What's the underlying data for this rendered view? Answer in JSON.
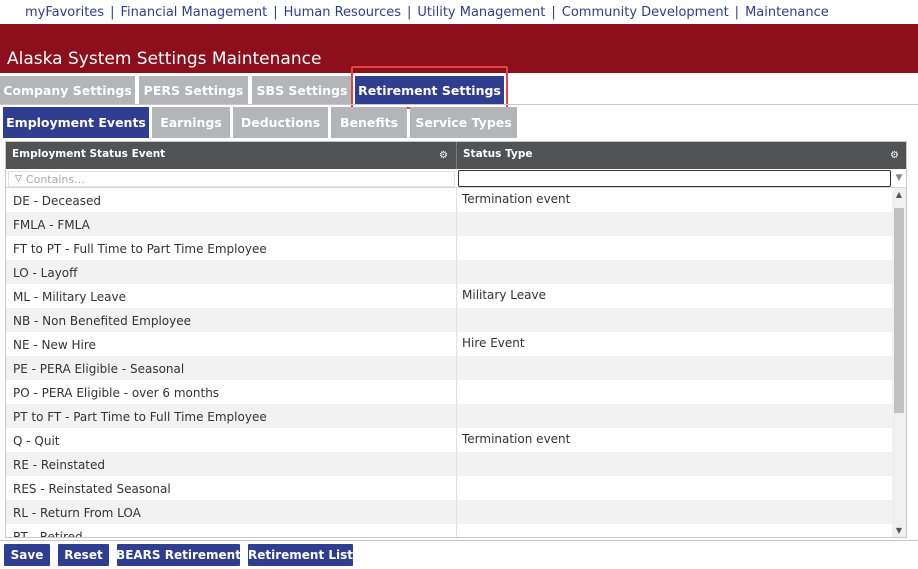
{
  "topnav": {
    "items": [
      "myFavorites",
      "Financial Management",
      "Human Resources",
      "Utility Management",
      "Community Development",
      "Maintenance"
    ],
    "separator": "|"
  },
  "header": {
    "title": "Alaska System Settings Maintenance"
  },
  "primary_tabs": [
    {
      "label": "Company Settings",
      "active": false
    },
    {
      "label": "PERS Settings",
      "active": false
    },
    {
      "label": "SBS Settings",
      "active": false
    },
    {
      "label": "Retirement Settings",
      "active": true
    }
  ],
  "secondary_tabs": [
    {
      "label": "Employment Events",
      "active": true
    },
    {
      "label": "Earnings",
      "active": false
    },
    {
      "label": "Deductions",
      "active": false
    },
    {
      "label": "Benefits",
      "active": false
    },
    {
      "label": "Service Types",
      "active": false
    }
  ],
  "grid": {
    "columns": [
      "Employment Status Event",
      "Status Type"
    ],
    "filter_placeholder": "Contains...",
    "status_type_filter_value": "",
    "rows": [
      [
        "DE - Deceased",
        "Termination event"
      ],
      [
        "FMLA - FMLA",
        ""
      ],
      [
        "FT to PT - Full Time to Part Time Employee",
        ""
      ],
      [
        "LO - Layoff",
        ""
      ],
      [
        "ML - Military Leave",
        "Military Leave"
      ],
      [
        "NB - Non Benefited Employee",
        ""
      ],
      [
        "NE - New Hire",
        "Hire Event"
      ],
      [
        "PE - PERA Eligible - Seasonal",
        ""
      ],
      [
        "PO - PERA Eligible - over 6 months",
        ""
      ],
      [
        "PT to FT - Part Time to Full Time Employee",
        ""
      ],
      [
        "Q - Quit",
        "Termination event"
      ],
      [
        "RE - Reinstated",
        ""
      ],
      [
        "RES - Reinstated Seasonal",
        ""
      ],
      [
        "RL - Return From LOA",
        ""
      ],
      [
        "RT - Retired",
        ""
      ]
    ]
  },
  "buttons": {
    "save": "Save",
    "reset": "Reset",
    "bears_retirement": "BEARS Retirement",
    "retirement_list": "Retirement List"
  },
  "colors": {
    "brand_red": "#8e0f1c",
    "accent_blue": "#2f3e8f",
    "inactive_tab": "#b3b5b9",
    "grid_header": "#505254",
    "highlight_box": "#e8414a"
  },
  "icons": {
    "column_menu": "gear-icon",
    "filter": "funnel-icon",
    "dropdown": "chevron-down-icon"
  }
}
